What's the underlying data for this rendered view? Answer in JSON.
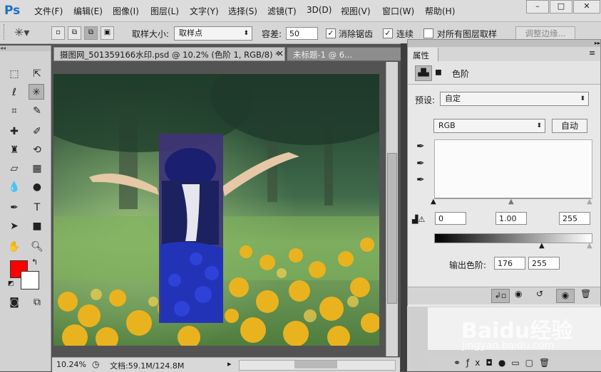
{
  "app": {
    "logo": "Ps"
  },
  "menu": [
    "文件(F)",
    "编辑(E)",
    "图像(I)",
    "图层(L)",
    "文字(Y)",
    "选择(S)",
    "滤镜(T)",
    "3D(D)",
    "视图(V)",
    "窗口(W)",
    "帮助(H)"
  ],
  "window_controls": {
    "minimize": "–",
    "maximize": "□",
    "close": "✕"
  },
  "options": {
    "sample_size_label": "取样大小:",
    "sample_size_value": "取样点",
    "tolerance_label": "容差:",
    "tolerance_value": "50",
    "anti_alias_label": "消除锯齿",
    "contiguous_label": "连续",
    "sample_all_layers_label": "对所有图层取样",
    "refine_edge_label": "调整边缘..."
  },
  "tabs": [
    {
      "title": "摄图网_501359166水印.psd @ 10.2% (色阶 1, RGB/8) *",
      "close": "×"
    },
    {
      "title": "未标题-1 @ 6...",
      "close": ""
    }
  ],
  "status": {
    "zoom": "10.24%",
    "doc_info": "文档:59.1M/124.8M"
  },
  "properties": {
    "panel_title": "属性",
    "adjustment_name": "色阶",
    "preset_label": "预设:",
    "preset_value": "自定",
    "channel_value": "RGB",
    "auto_button": "自动",
    "input_black": "0",
    "input_gamma": "1.00",
    "input_white": "255",
    "output_label": "输出色阶:",
    "output_black": "176",
    "output_white": "255"
  },
  "watermark": {
    "brand": "Baidu经验",
    "url": "jingyan.baidu.com"
  }
}
